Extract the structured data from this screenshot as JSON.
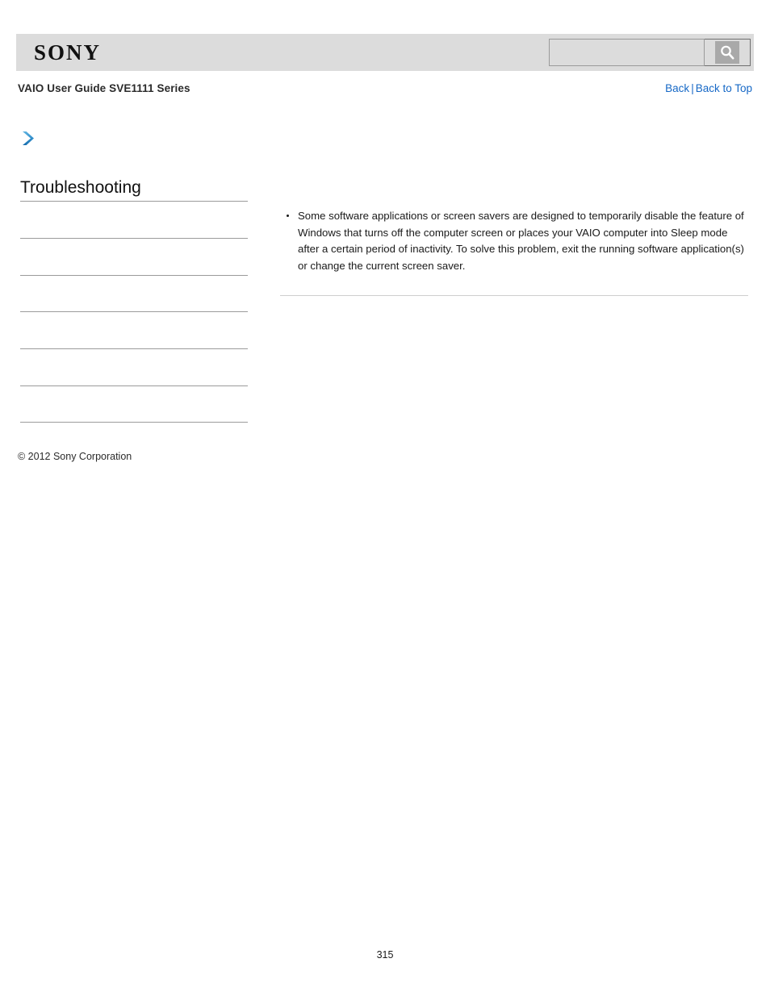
{
  "header": {
    "logo_text": "SONY",
    "logo_name": "sony-logo",
    "band_color": "#dcdcdc"
  },
  "search": {
    "value": "",
    "placeholder": "",
    "button_icon": "search-icon",
    "button_label": ""
  },
  "subheader": {
    "guide_title": "VAIO User Guide SVE1111 Series",
    "links": [
      {
        "label": "Back"
      },
      {
        "label": "Back to Top"
      }
    ],
    "separator": "|",
    "link_color": "#1668c6"
  },
  "breadcrumb": {
    "arrow_icon": "chevron-right-icon",
    "arrow_color": "#2e8bc8",
    "label": ""
  },
  "sidebar": {
    "title": "Troubleshooting",
    "items": [
      {
        "label": ""
      },
      {
        "label": ""
      },
      {
        "label": ""
      },
      {
        "label": ""
      },
      {
        "label": ""
      },
      {
        "label": ""
      }
    ]
  },
  "main": {
    "bullets": [
      "Some software applications or screen savers are designed to temporarily disable the feature of Windows that turns off the computer screen or places your VAIO computer into Sleep mode after a certain period of inactivity. To solve this problem, exit the running software application(s) or change the current screen saver."
    ]
  },
  "footer": {
    "copyright": "© 2012 Sony Corporation",
    "page_number": "315"
  }
}
